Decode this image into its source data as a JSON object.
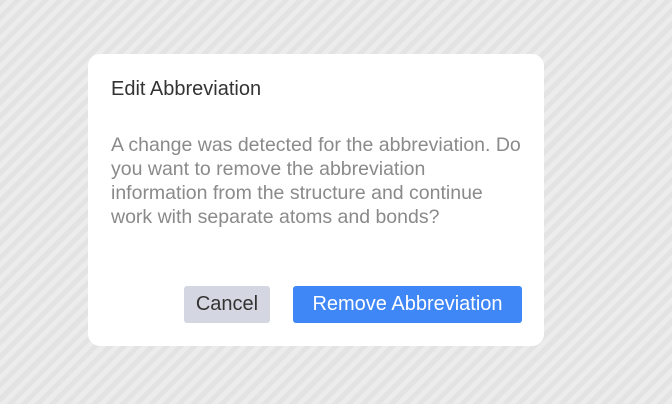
{
  "dialog": {
    "title": "Edit Abbreviation",
    "message": "A change was detected for the abbreviation. Do you want to remove the abbreviation information from the structure and continue work with separate atoms and bonds?",
    "cancel_label": "Cancel",
    "confirm_label": "Remove Abbreviation"
  },
  "colors": {
    "primary_button": "#3f86f7",
    "secondary_button": "#d4d7e1",
    "message_text": "#8a8a8a"
  }
}
